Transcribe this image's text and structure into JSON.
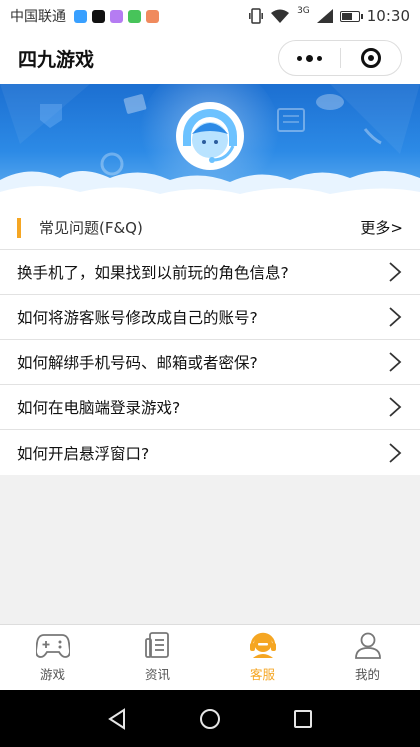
{
  "status_bar": {
    "carrier": "中国联通",
    "network": "3G",
    "time": "10:30"
  },
  "nav": {
    "title": "四九游戏"
  },
  "faq": {
    "header_title": "常见问题(F&Q)",
    "more_label": "更多>",
    "items": [
      {
        "question": "换手机了，如果找到以前玩的角色信息?"
      },
      {
        "question": "如何将游客账号修改成自己的账号?"
      },
      {
        "question": "如何解绑手机号码、邮箱或者密保?"
      },
      {
        "question": "如何在电脑端登录游戏?"
      },
      {
        "question": "如何开启悬浮窗口?"
      }
    ]
  },
  "tabs": [
    {
      "label": "游戏",
      "icon": "gamepad-icon",
      "active": false
    },
    {
      "label": "资讯",
      "icon": "news-icon",
      "active": false
    },
    {
      "label": "客服",
      "icon": "headset-icon",
      "active": true
    },
    {
      "label": "我的",
      "icon": "user-icon",
      "active": false
    }
  ],
  "colors": {
    "accent": "#f5a623",
    "banner_blue": "#2c8ae6",
    "page_bg": "#f1f1f1"
  }
}
